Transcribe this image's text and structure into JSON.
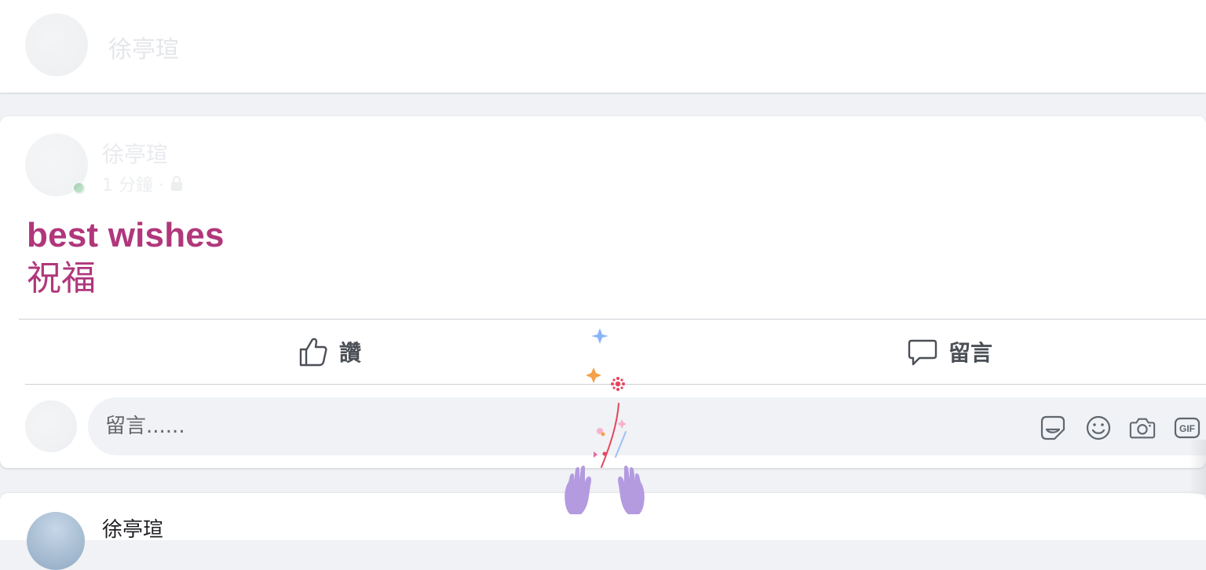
{
  "top_card": {
    "author_name": "徐亭瑄"
  },
  "post": {
    "author_name": "徐亭瑄",
    "meta": "1 分鐘 ·",
    "title": "best wishes",
    "subtitle": "祝福",
    "title_color": "#b0377b"
  },
  "actions": {
    "like_label": "讚",
    "comment_label": "留言"
  },
  "composer": {
    "placeholder": "留言......",
    "icons": [
      "sticker-icon",
      "emoji-icon",
      "camera-icon",
      "gif-icon"
    ],
    "gif_label": "GIF"
  },
  "bottom_card": {
    "author_name": "徐亭瑄"
  }
}
